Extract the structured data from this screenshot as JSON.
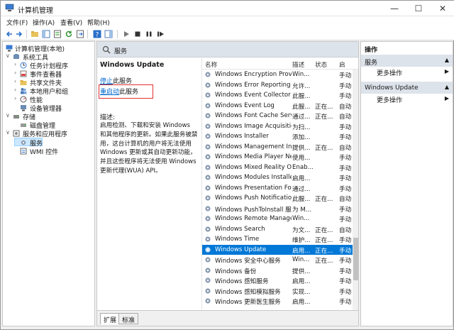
{
  "window": {
    "title": "计算机管理"
  },
  "menu": [
    "文件(F)",
    "操作(A)",
    "查看(V)",
    "帮助(H)"
  ],
  "tree": {
    "root": "计算机管理(本地)",
    "items": [
      {
        "label": "系统工具"
      },
      {
        "label": "任务计划程序"
      },
      {
        "label": "事件查看器"
      },
      {
        "label": "共享文件夹"
      },
      {
        "label": "本地用户和组"
      },
      {
        "label": "性能"
      },
      {
        "label": "设备管理器"
      },
      {
        "label": "存储"
      },
      {
        "label": "磁盘管理"
      },
      {
        "label": "服务和应用程序"
      },
      {
        "label": "服务"
      },
      {
        "label": "WMI 控件"
      }
    ]
  },
  "center": {
    "header": "服务",
    "service_title": "Windows Update",
    "stop_link": "停止",
    "stop_suffix": "此服务",
    "restart_link": "重启动",
    "restart_suffix": "此服务",
    "desc_label": "描述:",
    "desc_body": "启用检测、下载和安装 Windows 和其他程序的更新。如果此服务被禁用，这台计算机的用户将无法使用 Windows 更新或其自动更新功能，并且这些程序将无法使用 Windows 更新代理(WUA) API。",
    "columns": [
      "名称",
      "描述",
      "状态",
      "启"
    ],
    "rows": [
      [
        "Windows Encryption Provid...",
        "Win...",
        "",
        "手动"
      ],
      [
        "Windows Error Reporting S...",
        "允许...",
        "",
        "手动"
      ],
      [
        "Windows Event Collector",
        "此服...",
        "",
        "手动"
      ],
      [
        "Windows Event Log",
        "此服...",
        "正在...",
        "自动"
      ],
      [
        "Windows Font Cache Servi...",
        "通过...",
        "正在...",
        "自动"
      ],
      [
        "Windows Image Acquisitio...",
        "为扫...",
        "",
        "手动"
      ],
      [
        "Windows Installer",
        "添加...",
        "",
        "手动"
      ],
      [
        "Windows Management Ins...",
        "提供...",
        "正在...",
        "自动"
      ],
      [
        "Windows Media Player Net...",
        "使用...",
        "",
        "手动"
      ],
      [
        "Windows Mixed Reality Op...",
        "Enab...",
        "",
        "手动"
      ],
      [
        "Windows Modules Installer",
        "启用...",
        "",
        "手动"
      ],
      [
        "Windows Presentation Fou...",
        "通过...",
        "",
        "手动"
      ],
      [
        "Windows Push Notification...",
        "此服...",
        "正在...",
        "自动"
      ],
      [
        "Windows PushToInstall 服务",
        "为 M...",
        "",
        "手动"
      ],
      [
        "Windows Remote Manage...",
        "Win...",
        "",
        "手动"
      ],
      [
        "Windows Search",
        "为文...",
        "正在...",
        "自动"
      ],
      [
        "Windows Time",
        "维护...",
        "正在...",
        "手动"
      ],
      [
        "Windows Update",
        "启用...",
        "正在...",
        "手动"
      ],
      [
        "Windows 安全中心服务",
        "Win...",
        "正在...",
        "手动"
      ],
      [
        "Windows 备份",
        "提供...",
        "",
        "手动"
      ],
      [
        "Windows 感知服务",
        "启用...",
        "",
        "手动"
      ],
      [
        "Windows 感知模拟服务",
        "实现...",
        "",
        "手动"
      ],
      [
        "Windows 更新医生服务",
        "启用...",
        "",
        "手动"
      ]
    ],
    "selected_row": "Windows Update",
    "tabs": [
      "扩展",
      "标准"
    ]
  },
  "actions": {
    "title": "操作",
    "sections": [
      {
        "label": "服务",
        "more": "更多操作"
      },
      {
        "label": "Windows Update",
        "more": "更多操作"
      }
    ]
  },
  "colors": {
    "selection": "#0078d7",
    "link": "#0066cc",
    "highlight_box": "#e23030"
  }
}
